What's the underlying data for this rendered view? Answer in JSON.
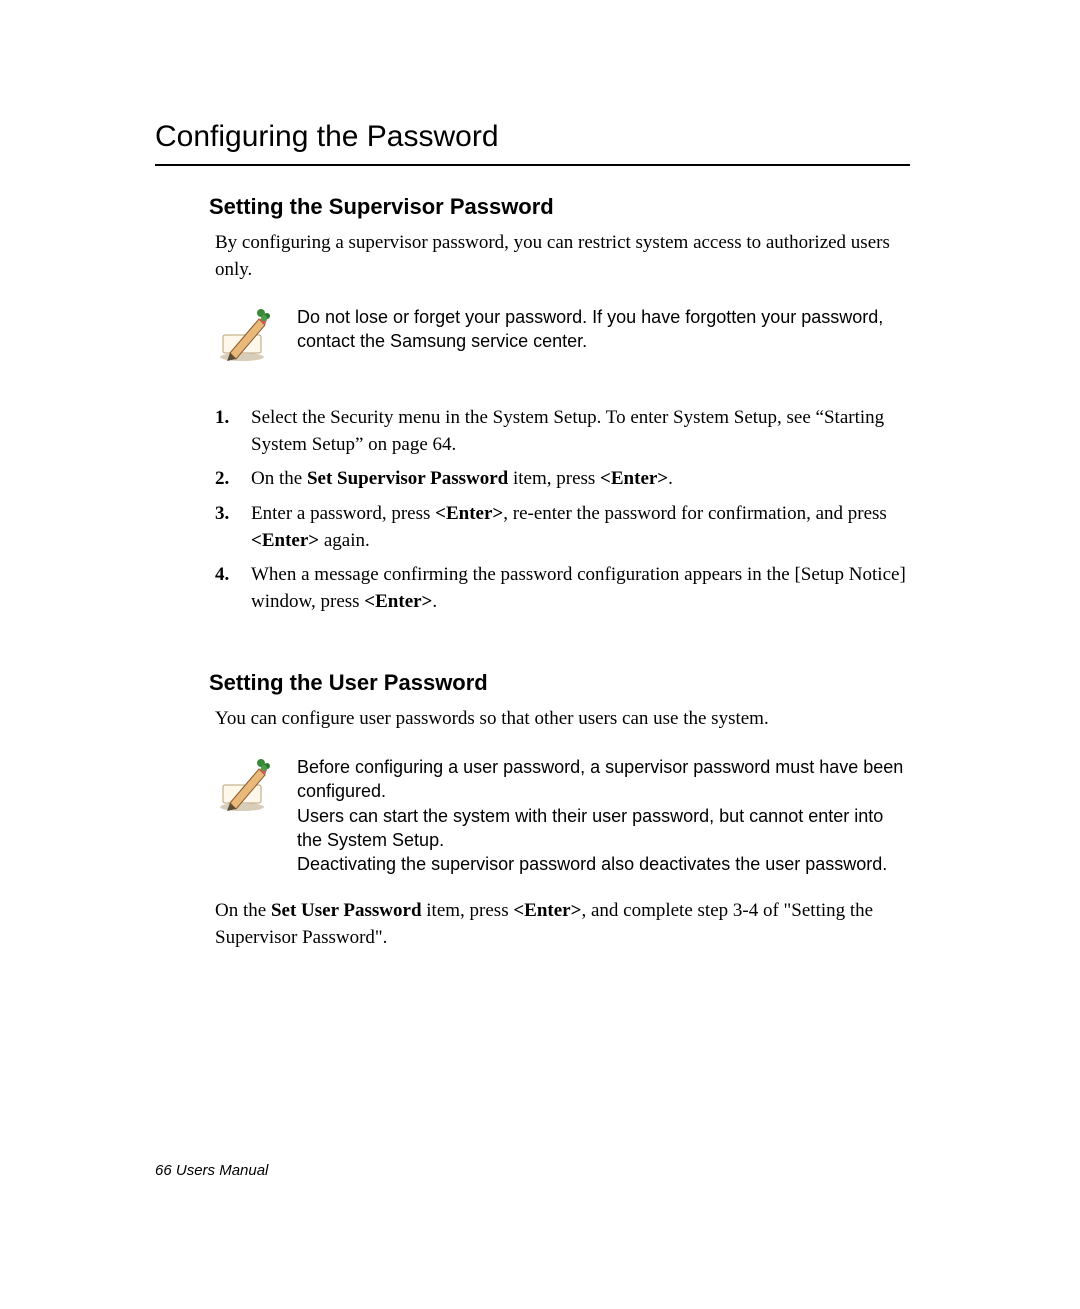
{
  "title": "Configuring the Password",
  "section1": {
    "heading": "Setting the Supervisor Password",
    "intro": "By configuring a supervisor password, you can restrict system access to authorized users only.",
    "note": "Do not lose or forget your password. If you have forgotten your password, contact the Samsung service center.",
    "steps": {
      "s1a": "Select the Security menu in the System Setup. To enter System Setup, see “Starting System Setup” on page 64.",
      "s2a": "On the ",
      "s2b": "Set Supervisor Password",
      "s2c": " item, press ",
      "s2d": "<Enter>",
      "s2e": ".",
      "s3a": "Enter a password, press ",
      "s3b": "<Enter>",
      "s3c": ", re-enter the password for confirmation, and press ",
      "s3d": "<Enter>",
      "s3e": " again.",
      "s4a": "When a message confirming the password configuration appears in the [Setup Notice] window, press ",
      "s4b": "<Enter>",
      "s4c": "."
    }
  },
  "section2": {
    "heading": "Setting the User Password",
    "intro": "You can configure user passwords so that other users can use the system.",
    "note_l1": "Before configuring a user password, a supervisor password must have been configured.",
    "note_l2": "Users can start the system with their user password, but cannot enter into the System Setup.",
    "note_l3": "Deactivating the supervisor password also deactivates the user password.",
    "final_a": "On the ",
    "final_b": "Set User Password",
    "final_c": " item, press ",
    "final_d": "<Enter>",
    "final_e": ", and complete step 3-4 of \"Setting the Supervisor Password\"."
  },
  "footer_page": "66",
  "footer_label": "  Users Manual"
}
